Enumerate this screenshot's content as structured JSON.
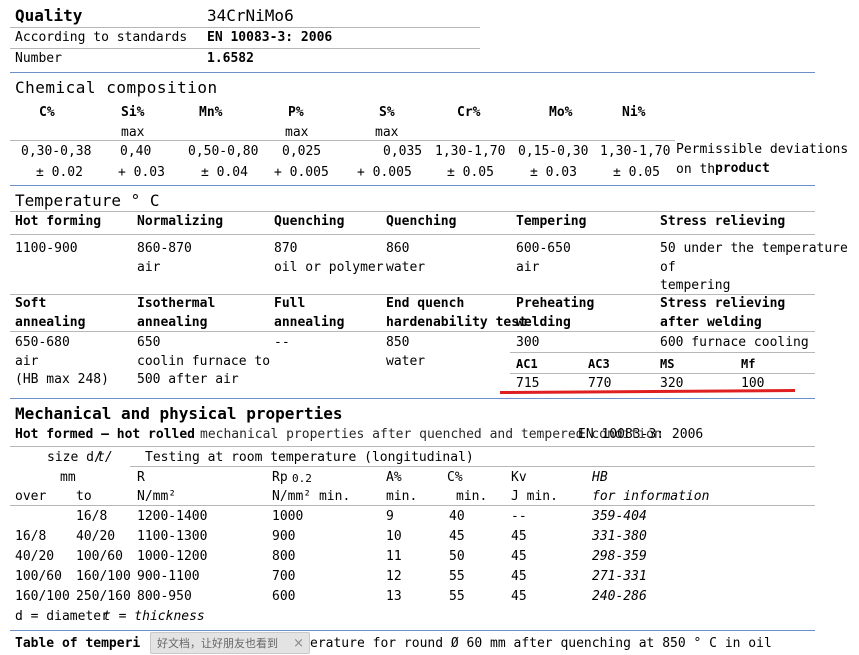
{
  "header": {
    "quality_label": "Quality",
    "quality_value": "34CrNiMo6",
    "standard_label": "According to standards",
    "standard_value": "EN 10083-3: 2006",
    "number_label": "Number",
    "number_value": "1.6582"
  },
  "chem": {
    "title": "Chemical composition",
    "cols": [
      "C%",
      "Si%",
      "Mn%",
      "P%",
      "S%",
      "Cr%",
      "Mo%",
      "Ni%"
    ],
    "max1": "max",
    "max2": "max",
    "max3": "max",
    "values": [
      "0,30-0,38",
      "0,40",
      "0,50-0,80",
      "0,025",
      "0,035",
      "1,30-1,70",
      "0,15-0,30",
      "1,30-1,70"
    ],
    "deviations": [
      "± 0.02",
      "+ 0.03",
      "± 0.04",
      "+ 0.005",
      "+ 0.005",
      "± 0.05",
      "± 0.03",
      "± 0.05"
    ],
    "note1": "Permissible deviations",
    "note2a": "on th",
    "note2b": "product"
  },
  "temp": {
    "title": "Temperature ° C",
    "h1": [
      "Hot forming",
      "Normalizing",
      "Quenching",
      "Quenching",
      "Tempering",
      "Stress relieving"
    ],
    "r1": [
      "1100-900",
      "860-870",
      "870",
      "860",
      "600-650",
      "50 under the temperature"
    ],
    "r1b": [
      "air",
      "oil or polymer",
      "water",
      "air",
      "of"
    ],
    "r1c": "tempering",
    "h2a": [
      "Soft",
      "Isothermal",
      "Full",
      "End quench",
      "Preheating",
      "Stress relieving"
    ],
    "h2b": [
      "annealing",
      "annealing",
      "annealing",
      "hardenability test",
      "welding",
      "after welding"
    ],
    "r2a": [
      "650-680",
      "650",
      "--",
      "850",
      "300",
      "600 furnace cooling"
    ],
    "r2b": [
      "air",
      "coolin furnace to",
      "water"
    ],
    "r2c": [
      "(HB max 248)",
      "500 after air"
    ],
    "ac_labels": [
      "AC1",
      "AC3",
      "MS",
      "Mf"
    ],
    "ac_values": [
      "715",
      "770",
      "320",
      "100"
    ]
  },
  "mech": {
    "title": "Mechanical and physical properties",
    "subtitle1": "Hot formed – hot rolled",
    "subtitle_overlap": "mechanical properties after quenched and tempered condition",
    "subtitle2": "EN 10083-3: 2006",
    "size_label": "size d/",
    "size_label2": "t/",
    "testing": "Testing at room temperature (longitudinal)",
    "mm": "mm",
    "col_r": "R",
    "col_rp": "Rp",
    "col_rp_sub": "0.2",
    "col_a": "A%",
    "col_c": "C%",
    "col_kv": "Kv",
    "col_hb": "HB",
    "over": "over",
    "to": "to",
    "u_r": "N/mm² ",
    "u_rp": "N/mm² min.",
    "u_a": "min.",
    "u_c": "min.",
    "u_kv": "J min.",
    "u_hb": "for information",
    "rows": [
      {
        "over": "",
        "to": "16/8",
        "r": "1200-1400",
        "rp": "1000",
        "a": "9",
        "c": "40",
        "kv": "--",
        "hb": "359-404"
      },
      {
        "over": "16/8",
        "to": "40/20",
        "r": "1100-1300",
        "rp": "900",
        "a": "10",
        "c": "45",
        "kv": "45",
        "hb": "331-380"
      },
      {
        "over": "40/20",
        "to": "100/60",
        "r": "1000-1200",
        "rp": "800",
        "a": "11",
        "c": "50",
        "kv": "45",
        "hb": "298-359"
      },
      {
        "over": "100/60",
        "to": "160/100",
        "r": "900-1100",
        "rp": "700",
        "a": "12",
        "c": "55",
        "kv": "45",
        "hb": "271-331"
      },
      {
        "over": "160/100",
        "to": "250/160",
        "r": "800-950",
        "rp": "600",
        "a": "13",
        "c": "55",
        "kv": "45",
        "hb": "240-286"
      }
    ],
    "footnote": "d = diameter",
    "footnote2": "t = thickness"
  },
  "tempering": {
    "title_a": "Table of temperi",
    "title_b": "erature for round Ø 60 mm after quenching at  850 ° C in oil"
  },
  "toast": {
    "text": "好文档，让好朋友也看到",
    "close": "×"
  }
}
